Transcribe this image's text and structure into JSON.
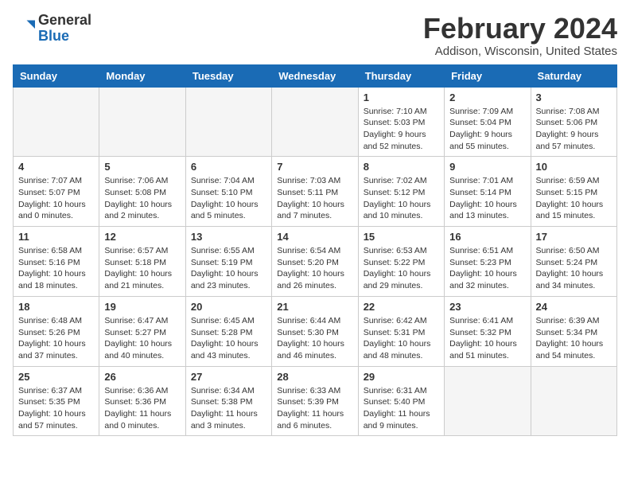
{
  "logo": {
    "general": "General",
    "blue": "Blue"
  },
  "header": {
    "month_title": "February 2024",
    "location": "Addison, Wisconsin, United States"
  },
  "weekdays": [
    "Sunday",
    "Monday",
    "Tuesday",
    "Wednesday",
    "Thursday",
    "Friday",
    "Saturday"
  ],
  "weeks": [
    [
      {
        "day": "",
        "info": ""
      },
      {
        "day": "",
        "info": ""
      },
      {
        "day": "",
        "info": ""
      },
      {
        "day": "",
        "info": ""
      },
      {
        "day": "1",
        "info": "Sunrise: 7:10 AM\nSunset: 5:03 PM\nDaylight: 9 hours\nand 52 minutes."
      },
      {
        "day": "2",
        "info": "Sunrise: 7:09 AM\nSunset: 5:04 PM\nDaylight: 9 hours\nand 55 minutes."
      },
      {
        "day": "3",
        "info": "Sunrise: 7:08 AM\nSunset: 5:06 PM\nDaylight: 9 hours\nand 57 minutes."
      }
    ],
    [
      {
        "day": "4",
        "info": "Sunrise: 7:07 AM\nSunset: 5:07 PM\nDaylight: 10 hours\nand 0 minutes."
      },
      {
        "day": "5",
        "info": "Sunrise: 7:06 AM\nSunset: 5:08 PM\nDaylight: 10 hours\nand 2 minutes."
      },
      {
        "day": "6",
        "info": "Sunrise: 7:04 AM\nSunset: 5:10 PM\nDaylight: 10 hours\nand 5 minutes."
      },
      {
        "day": "7",
        "info": "Sunrise: 7:03 AM\nSunset: 5:11 PM\nDaylight: 10 hours\nand 7 minutes."
      },
      {
        "day": "8",
        "info": "Sunrise: 7:02 AM\nSunset: 5:12 PM\nDaylight: 10 hours\nand 10 minutes."
      },
      {
        "day": "9",
        "info": "Sunrise: 7:01 AM\nSunset: 5:14 PM\nDaylight: 10 hours\nand 13 minutes."
      },
      {
        "day": "10",
        "info": "Sunrise: 6:59 AM\nSunset: 5:15 PM\nDaylight: 10 hours\nand 15 minutes."
      }
    ],
    [
      {
        "day": "11",
        "info": "Sunrise: 6:58 AM\nSunset: 5:16 PM\nDaylight: 10 hours\nand 18 minutes."
      },
      {
        "day": "12",
        "info": "Sunrise: 6:57 AM\nSunset: 5:18 PM\nDaylight: 10 hours\nand 21 minutes."
      },
      {
        "day": "13",
        "info": "Sunrise: 6:55 AM\nSunset: 5:19 PM\nDaylight: 10 hours\nand 23 minutes."
      },
      {
        "day": "14",
        "info": "Sunrise: 6:54 AM\nSunset: 5:20 PM\nDaylight: 10 hours\nand 26 minutes."
      },
      {
        "day": "15",
        "info": "Sunrise: 6:53 AM\nSunset: 5:22 PM\nDaylight: 10 hours\nand 29 minutes."
      },
      {
        "day": "16",
        "info": "Sunrise: 6:51 AM\nSunset: 5:23 PM\nDaylight: 10 hours\nand 32 minutes."
      },
      {
        "day": "17",
        "info": "Sunrise: 6:50 AM\nSunset: 5:24 PM\nDaylight: 10 hours\nand 34 minutes."
      }
    ],
    [
      {
        "day": "18",
        "info": "Sunrise: 6:48 AM\nSunset: 5:26 PM\nDaylight: 10 hours\nand 37 minutes."
      },
      {
        "day": "19",
        "info": "Sunrise: 6:47 AM\nSunset: 5:27 PM\nDaylight: 10 hours\nand 40 minutes."
      },
      {
        "day": "20",
        "info": "Sunrise: 6:45 AM\nSunset: 5:28 PM\nDaylight: 10 hours\nand 43 minutes."
      },
      {
        "day": "21",
        "info": "Sunrise: 6:44 AM\nSunset: 5:30 PM\nDaylight: 10 hours\nand 46 minutes."
      },
      {
        "day": "22",
        "info": "Sunrise: 6:42 AM\nSunset: 5:31 PM\nDaylight: 10 hours\nand 48 minutes."
      },
      {
        "day": "23",
        "info": "Sunrise: 6:41 AM\nSunset: 5:32 PM\nDaylight: 10 hours\nand 51 minutes."
      },
      {
        "day": "24",
        "info": "Sunrise: 6:39 AM\nSunset: 5:34 PM\nDaylight: 10 hours\nand 54 minutes."
      }
    ],
    [
      {
        "day": "25",
        "info": "Sunrise: 6:37 AM\nSunset: 5:35 PM\nDaylight: 10 hours\nand 57 minutes."
      },
      {
        "day": "26",
        "info": "Sunrise: 6:36 AM\nSunset: 5:36 PM\nDaylight: 11 hours\nand 0 minutes."
      },
      {
        "day": "27",
        "info": "Sunrise: 6:34 AM\nSunset: 5:38 PM\nDaylight: 11 hours\nand 3 minutes."
      },
      {
        "day": "28",
        "info": "Sunrise: 6:33 AM\nSunset: 5:39 PM\nDaylight: 11 hours\nand 6 minutes."
      },
      {
        "day": "29",
        "info": "Sunrise: 6:31 AM\nSunset: 5:40 PM\nDaylight: 11 hours\nand 9 minutes."
      },
      {
        "day": "",
        "info": ""
      },
      {
        "day": "",
        "info": ""
      }
    ]
  ]
}
